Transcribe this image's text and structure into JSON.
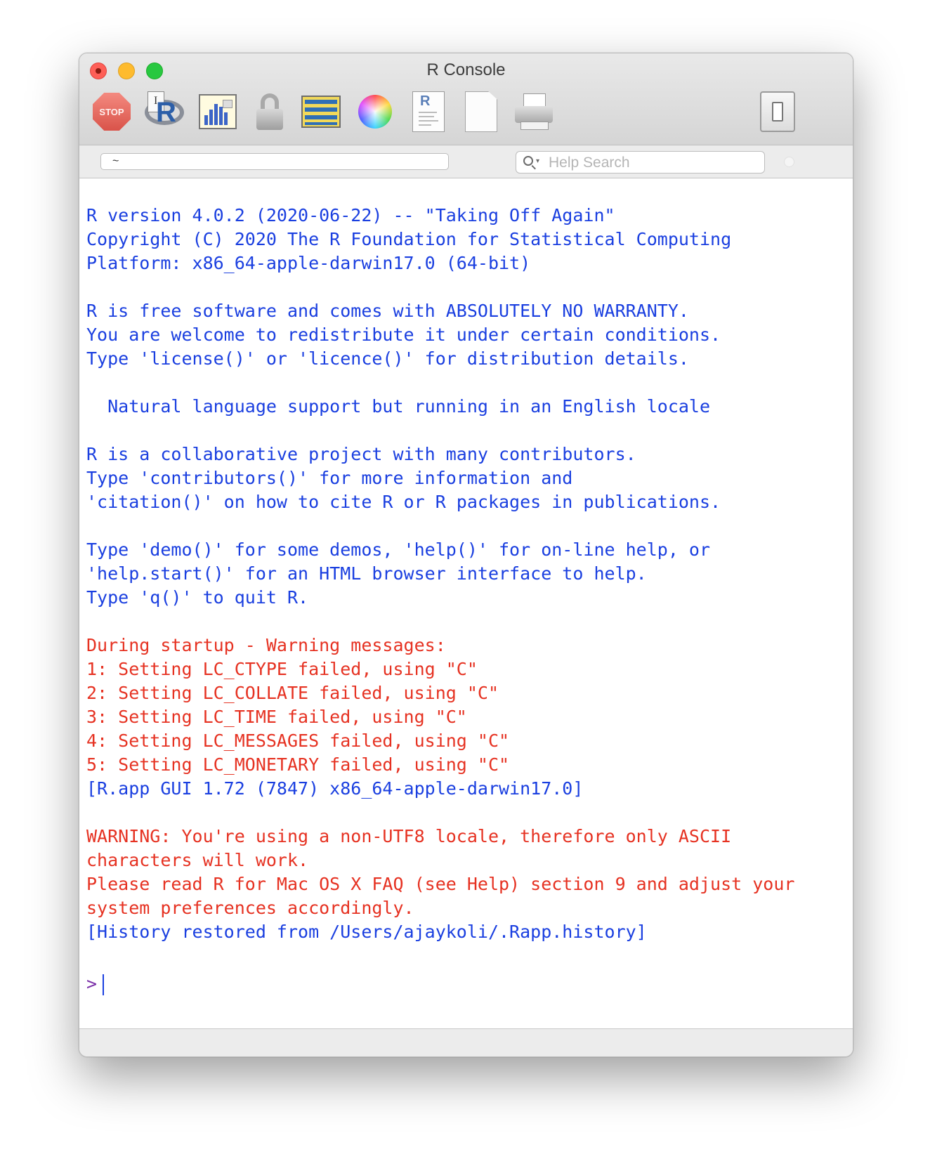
{
  "window": {
    "title": "R Console",
    "traffic_lights": [
      "close",
      "minimize",
      "zoom"
    ]
  },
  "toolbar": {
    "items": [
      {
        "name": "stop",
        "label": "STOP",
        "icon": "stop-sign-icon"
      },
      {
        "name": "source-script",
        "icon": "r-source-icon"
      },
      {
        "name": "quartz",
        "icon": "bar-chart-window-icon"
      },
      {
        "name": "authentication",
        "icon": "lock-icon"
      },
      {
        "name": "data-editor",
        "icon": "data-table-icon"
      },
      {
        "name": "colors",
        "icon": "color-wheel-icon"
      },
      {
        "name": "open-document",
        "icon": "r-document-icon"
      },
      {
        "name": "new-document",
        "icon": "blank-document-icon"
      },
      {
        "name": "print",
        "icon": "printer-icon"
      },
      {
        "name": "toggle-drawer",
        "icon": "drawer-toggle-icon"
      }
    ]
  },
  "pathbar": {
    "working_dir": "~",
    "search_placeholder": "Help Search"
  },
  "colors": {
    "output": "#1a3fe0",
    "warning": "#e63222",
    "prompt": "#7a2fa8"
  },
  "console": {
    "lines": [
      {
        "type": "output",
        "text": "R version 4.0.2 (2020-06-22) -- \"Taking Off Again\""
      },
      {
        "type": "output",
        "text": "Copyright (C) 2020 The R Foundation for Statistical Computing"
      },
      {
        "type": "output",
        "text": "Platform: x86_64-apple-darwin17.0 (64-bit)"
      },
      {
        "type": "blank",
        "text": ""
      },
      {
        "type": "output",
        "text": "R is free software and comes with ABSOLUTELY NO WARRANTY."
      },
      {
        "type": "output",
        "text": "You are welcome to redistribute it under certain conditions."
      },
      {
        "type": "output",
        "text": "Type 'license()' or 'licence()' for distribution details."
      },
      {
        "type": "blank",
        "text": ""
      },
      {
        "type": "output",
        "text": "  Natural language support but running in an English locale"
      },
      {
        "type": "blank",
        "text": ""
      },
      {
        "type": "output",
        "text": "R is a collaborative project with many contributors."
      },
      {
        "type": "output",
        "text": "Type 'contributors()' for more information and"
      },
      {
        "type": "output",
        "text": "'citation()' on how to cite R or R packages in publications."
      },
      {
        "type": "blank",
        "text": ""
      },
      {
        "type": "output",
        "text": "Type 'demo()' for some demos, 'help()' for on-line help, or"
      },
      {
        "type": "output",
        "text": "'help.start()' for an HTML browser interface to help."
      },
      {
        "type": "output",
        "text": "Type 'q()' to quit R."
      },
      {
        "type": "blank",
        "text": ""
      },
      {
        "type": "error",
        "text": "During startup - Warning messages:"
      },
      {
        "type": "error",
        "text": "1: Setting LC_CTYPE failed, using \"C\""
      },
      {
        "type": "error",
        "text": "2: Setting LC_COLLATE failed, using \"C\""
      },
      {
        "type": "error",
        "text": "3: Setting LC_TIME failed, using \"C\""
      },
      {
        "type": "error",
        "text": "4: Setting LC_MESSAGES failed, using \"C\""
      },
      {
        "type": "error",
        "text": "5: Setting LC_MONETARY failed, using \"C\""
      },
      {
        "type": "output",
        "text": "[R.app GUI 1.72 (7847) x86_64-apple-darwin17.0]"
      },
      {
        "type": "blank",
        "text": ""
      },
      {
        "type": "error",
        "text": "WARNING: You're using a non-UTF8 locale, therefore only ASCII"
      },
      {
        "type": "error",
        "text": "characters will work."
      },
      {
        "type": "error",
        "text": "Please read R for Mac OS X FAQ (see Help) section 9 and adjust your"
      },
      {
        "type": "error",
        "text": "system preferences accordingly."
      },
      {
        "type": "output",
        "text": "[History restored from /Users/ajaykoli/.Rapp.history]"
      },
      {
        "type": "blank",
        "text": ""
      }
    ],
    "prompt": ">"
  }
}
